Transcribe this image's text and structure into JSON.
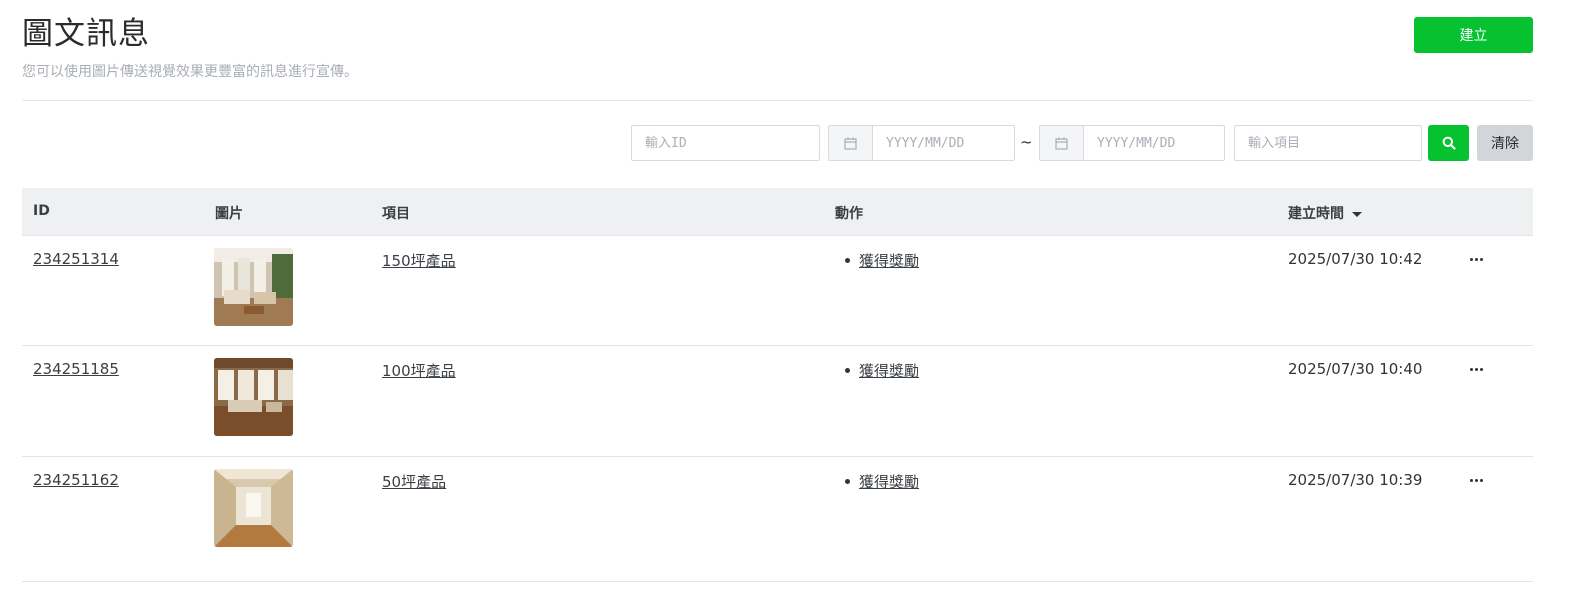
{
  "header": {
    "title": "圖文訊息",
    "subtitle": "您可以使用圖片傳送視覺效果更豐富的訊息進行宣傳。",
    "create_label": "建立"
  },
  "filters": {
    "id_placeholder": "輸入ID",
    "date_from_placeholder": "YYYY/MM/DD",
    "date_to_placeholder": "YYYY/MM/DD",
    "range_sep": "~",
    "item_placeholder": "輸入項目",
    "clear_label": "清除"
  },
  "table": {
    "columns": [
      "ID",
      "圖片",
      "項目",
      "動作",
      "建立時間"
    ],
    "rows": [
      {
        "id": "234251314",
        "item": "150坪產品",
        "action": "獲得獎勵",
        "created": "2025/07/30 10:42"
      },
      {
        "id": "234251185",
        "item": "100坪產品",
        "action": "獲得獎勵",
        "created": "2025/07/30 10:40"
      },
      {
        "id": "234251162",
        "item": "50坪產品",
        "action": "獲得獎勵",
        "created": "2025/07/30 10:39"
      }
    ]
  },
  "colors": {
    "accent": "#06c130",
    "clear_bg": "#d2d6db",
    "header_bg": "#eff0f2"
  }
}
